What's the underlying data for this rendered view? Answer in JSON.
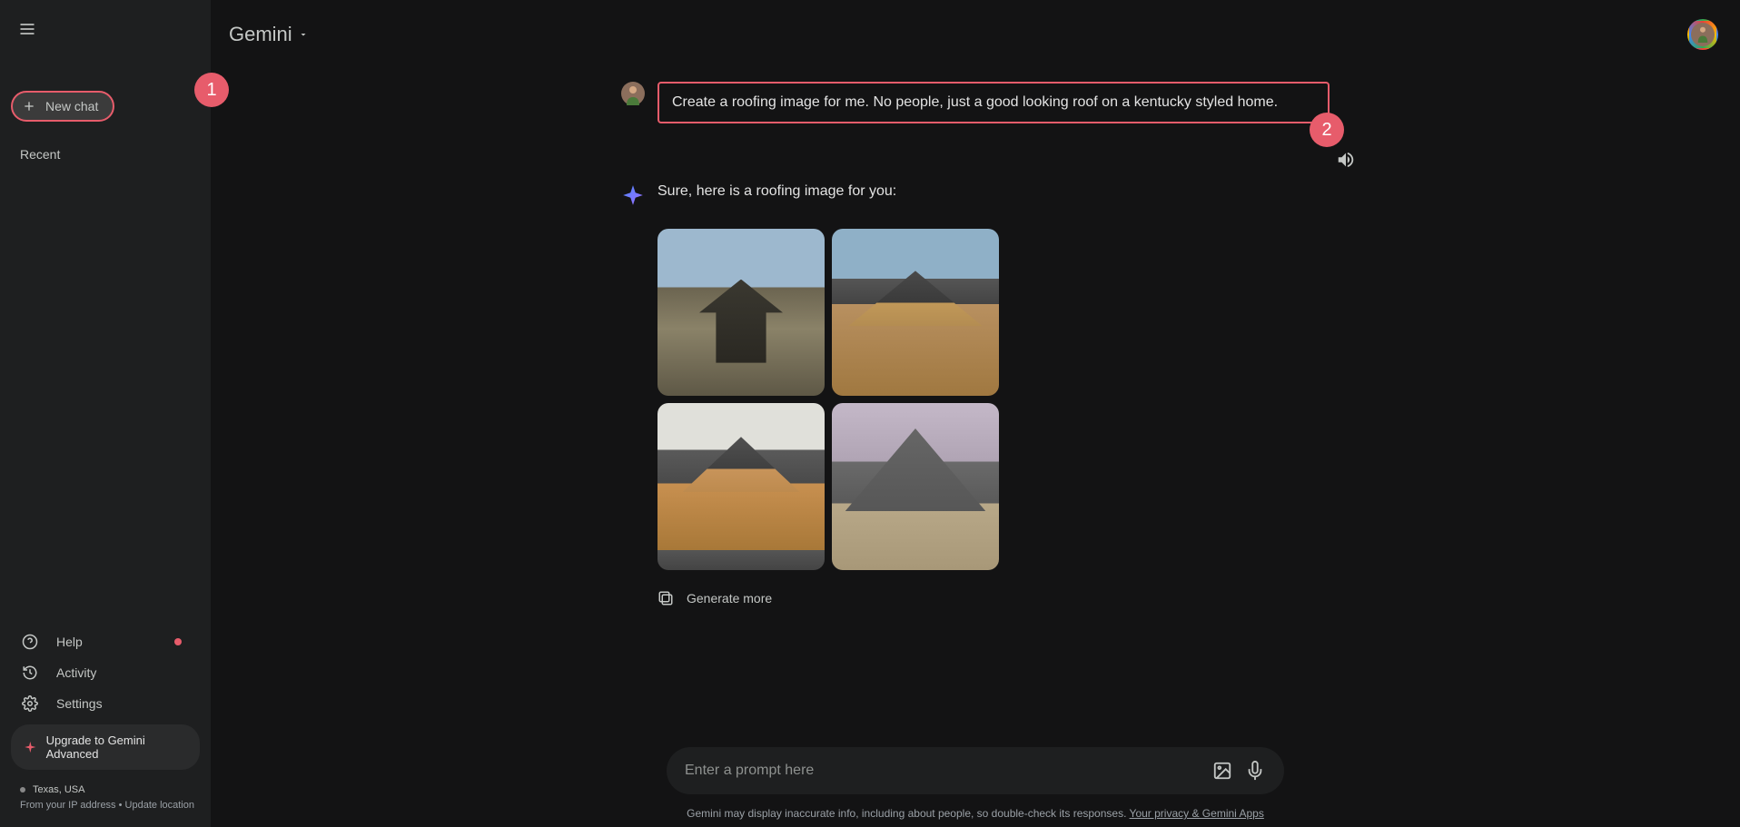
{
  "sidebar": {
    "new_chat_label": "New chat",
    "recent_label": "Recent",
    "help_label": "Help",
    "activity_label": "Activity",
    "settings_label": "Settings",
    "upgrade_label": "Upgrade to Gemini Advanced",
    "location_title": "Texas, USA",
    "location_sub1": "From your IP address",
    "location_dot": "•",
    "location_sub2": "Update location"
  },
  "badges": {
    "one": "1",
    "two": "2"
  },
  "header": {
    "brand": "Gemini"
  },
  "conversation": {
    "user_prompt": "Create a roofing image for me. No people, just a good looking roof on a kentucky styled home.",
    "assistant_intro": "Sure, here is a roofing image for you:",
    "generate_more_label": "Generate more"
  },
  "input": {
    "placeholder": "Enter a prompt here"
  },
  "footer": {
    "disclaimer_text": "Gemini may display inaccurate info, including about people, so double-check its responses.",
    "privacy_link": "Your privacy & Gemini Apps"
  }
}
